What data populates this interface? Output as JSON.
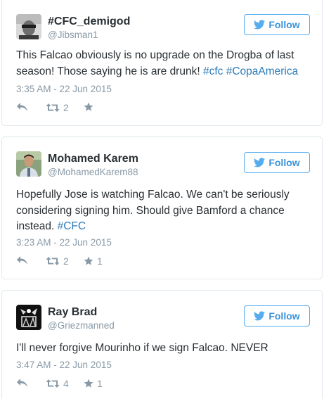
{
  "follow_label": "Follow",
  "colors": {
    "accent": "#55acee",
    "link": "#2b7bb9",
    "text": "#292f33",
    "muted": "#8899a6",
    "border": "#e1e8ed"
  },
  "tweets": [
    {
      "name": "#CFC_demigod",
      "handle": "@Jibsman1",
      "text_parts": [
        {
          "text": "This Falcao obviously is no upgrade on the Drogba of last season! Those saying he is are drunk! ",
          "link": false
        },
        {
          "text": "#cfc",
          "link": true
        },
        {
          "text": " ",
          "link": false
        },
        {
          "text": "#CopaAmerica",
          "link": true
        }
      ],
      "timestamp": "3:35 AM - 22 Jun 2015",
      "retweets": "2",
      "likes": ""
    },
    {
      "name": "Mohamed Karem",
      "handle": "@MohamedKarem88",
      "text_parts": [
        {
          "text": "Hopefully Jose is watching Falcao. We can't be seriously considering signing him. Should give Bamford a chance instead. ",
          "link": false
        },
        {
          "text": "#CFC",
          "link": true
        }
      ],
      "timestamp": "3:23 AM - 22 Jun 2015",
      "retweets": "2",
      "likes": "1"
    },
    {
      "name": "Ray Brad",
      "handle": "@Griezmanned",
      "text_parts": [
        {
          "text": "I'll never forgive Mourinho if we sign Falcao. NEVER",
          "link": false
        }
      ],
      "timestamp": "3:47 AM - 22 Jun 2015",
      "retweets": "4",
      "likes": "1"
    }
  ]
}
